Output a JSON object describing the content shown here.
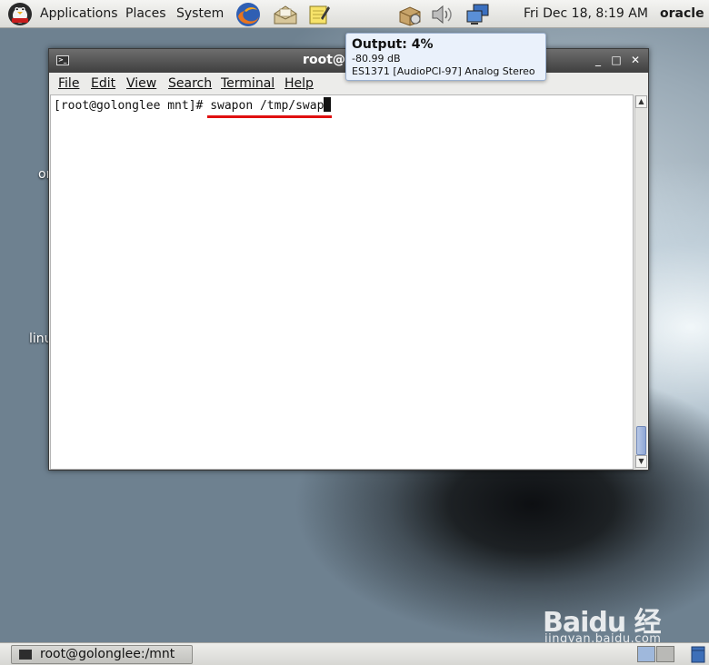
{
  "top_panel": {
    "menus": [
      "Applications",
      "Places",
      "System"
    ],
    "datetime": "Fri Dec 18,  8:19 AM",
    "user": "oracle",
    "launchers": [
      "firefox-icon",
      "mail-client-icon",
      "notes-editor-icon"
    ],
    "tray": [
      "package-updater-icon",
      "volume-icon",
      "network-icon"
    ]
  },
  "desktop": {
    "labels": [
      "or",
      "linu"
    ]
  },
  "tooltip": {
    "title": "Output: 4%",
    "db": "-80.99 dB",
    "device": "ES1371 [AudioPCI-97] Analog Stereo"
  },
  "terminal": {
    "title": "root@golong",
    "menu": [
      "File",
      "Edit",
      "View",
      "Search",
      "Terminal",
      "Help"
    ],
    "prompt": "[root@golonglee mnt]# ",
    "command": "swapon /tmp/swap",
    "window_buttons": [
      "_",
      "□",
      "✕"
    ],
    "annotation_color": "#e01010"
  },
  "bottom_panel": {
    "task_label": "root@golonglee:/mnt"
  },
  "watermark": {
    "logo": "Baidu 经验",
    "url": "jingyan.baidu.com"
  }
}
